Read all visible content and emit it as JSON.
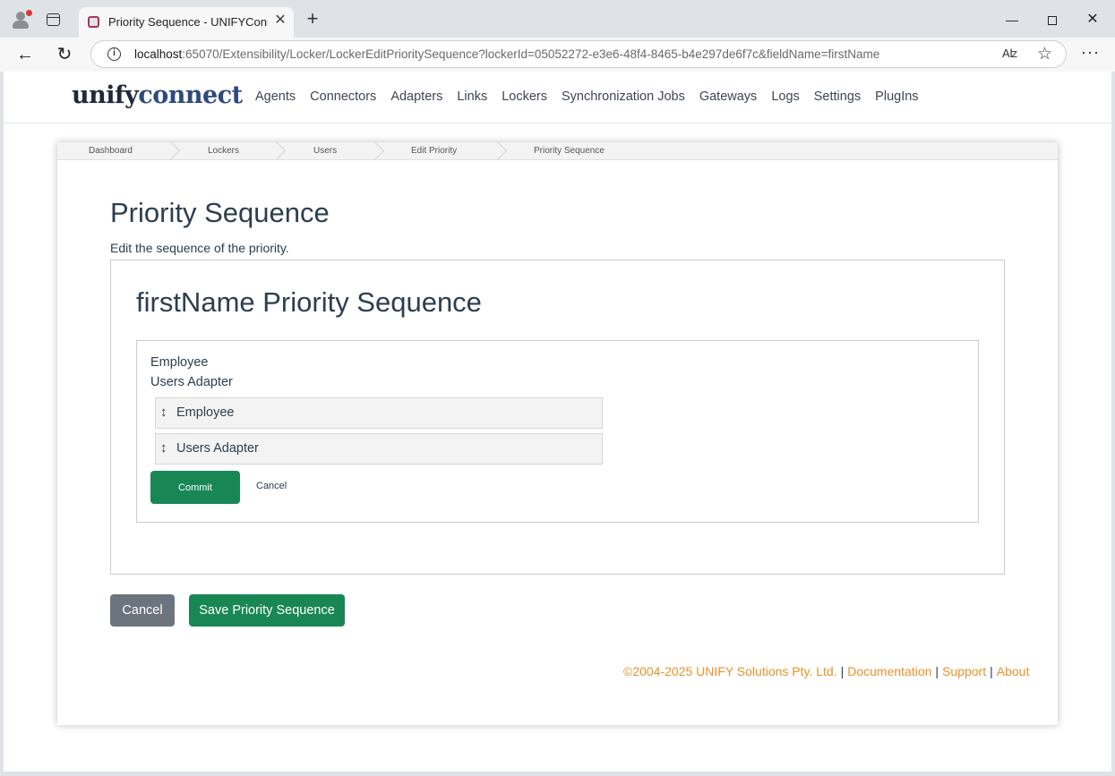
{
  "browser": {
    "tab_title": "Priority Sequence - UNIFYConnect",
    "tab_close": "✕",
    "new_tab": "+",
    "url_host": "localhost",
    "url_rest": ":65070/Extensibility/Locker/LockerEditPrioritySequence?lockerId=05052272-e3e6-48f4-8465-b4e297de6f7c&fieldName=firstName",
    "read_aloud": "Aʫ",
    "icons": [
      "profile-icon",
      "tab-actions-icon",
      "back-icon",
      "reload-icon",
      "info-icon",
      "read-aloud-icon",
      "favorite-star-icon",
      "more-menu-icon"
    ],
    "controls": {
      "minimize": "—",
      "close": "✕"
    }
  },
  "header": {
    "logo_part1": "unify",
    "logo_part2": "connect",
    "nav": [
      "Agents",
      "Connectors",
      "Adapters",
      "Links",
      "Lockers",
      "Synchronization Jobs",
      "Gateways",
      "Logs",
      "Settings",
      "PlugIns"
    ]
  },
  "breadcrumb": [
    "Dashboard",
    "Lockers",
    "Users",
    "Edit Priority",
    "Priority Sequence"
  ],
  "main": {
    "title": "Priority Sequence",
    "subtitle": "Edit the sequence of the priority.",
    "section_title": "firstName Priority Sequence",
    "plain_items": [
      "Employee",
      "Users Adapter"
    ],
    "sortable_items": [
      "Employee",
      "Users Adapter"
    ],
    "drag_handle": "↕",
    "commit_label": "Commit",
    "inner_cancel_label": "Cancel",
    "cancel_label": "Cancel",
    "save_label": "Save Priority Sequence"
  },
  "footer": {
    "copyright": "©2004-2025 UNIFY Solutions Pty. Ltd.",
    "links": [
      "Documentation",
      "Support",
      "About"
    ],
    "separator": "|"
  },
  "colors": {
    "primary_green": "#198754",
    "secondary_gray": "#6c757d",
    "footer_orange": "#e8922b",
    "text_dark": "#2c3e50",
    "logo_blue": "#2e4a7e"
  }
}
